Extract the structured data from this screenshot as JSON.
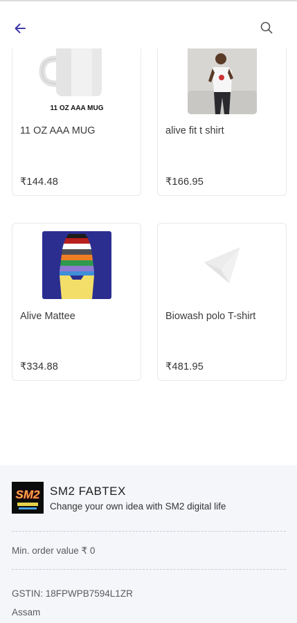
{
  "header": {
    "back_icon": "arrow-left-icon",
    "search_icon": "search-icon",
    "accent": "#3c3aa8"
  },
  "products": [
    {
      "name": "11 OZ AAA MUG",
      "price": "₹144.48",
      "image_caption": "11 OZ AAA MUG"
    },
    {
      "name": "alive fit t shirt",
      "price": "₹166.95"
    },
    {
      "name": "Alive Mattee",
      "price": "₹334.88"
    },
    {
      "name": "Biowash polo T-shirt",
      "price": "₹481.95"
    }
  ],
  "store": {
    "name": "SM2 FABTEX",
    "tagline": "Change your own idea with SM2 digital life",
    "min_order": "Min. order value ₹ 0",
    "gstin": "GSTIN: 18FPWPB7594L1ZR",
    "state": "Assam"
  }
}
